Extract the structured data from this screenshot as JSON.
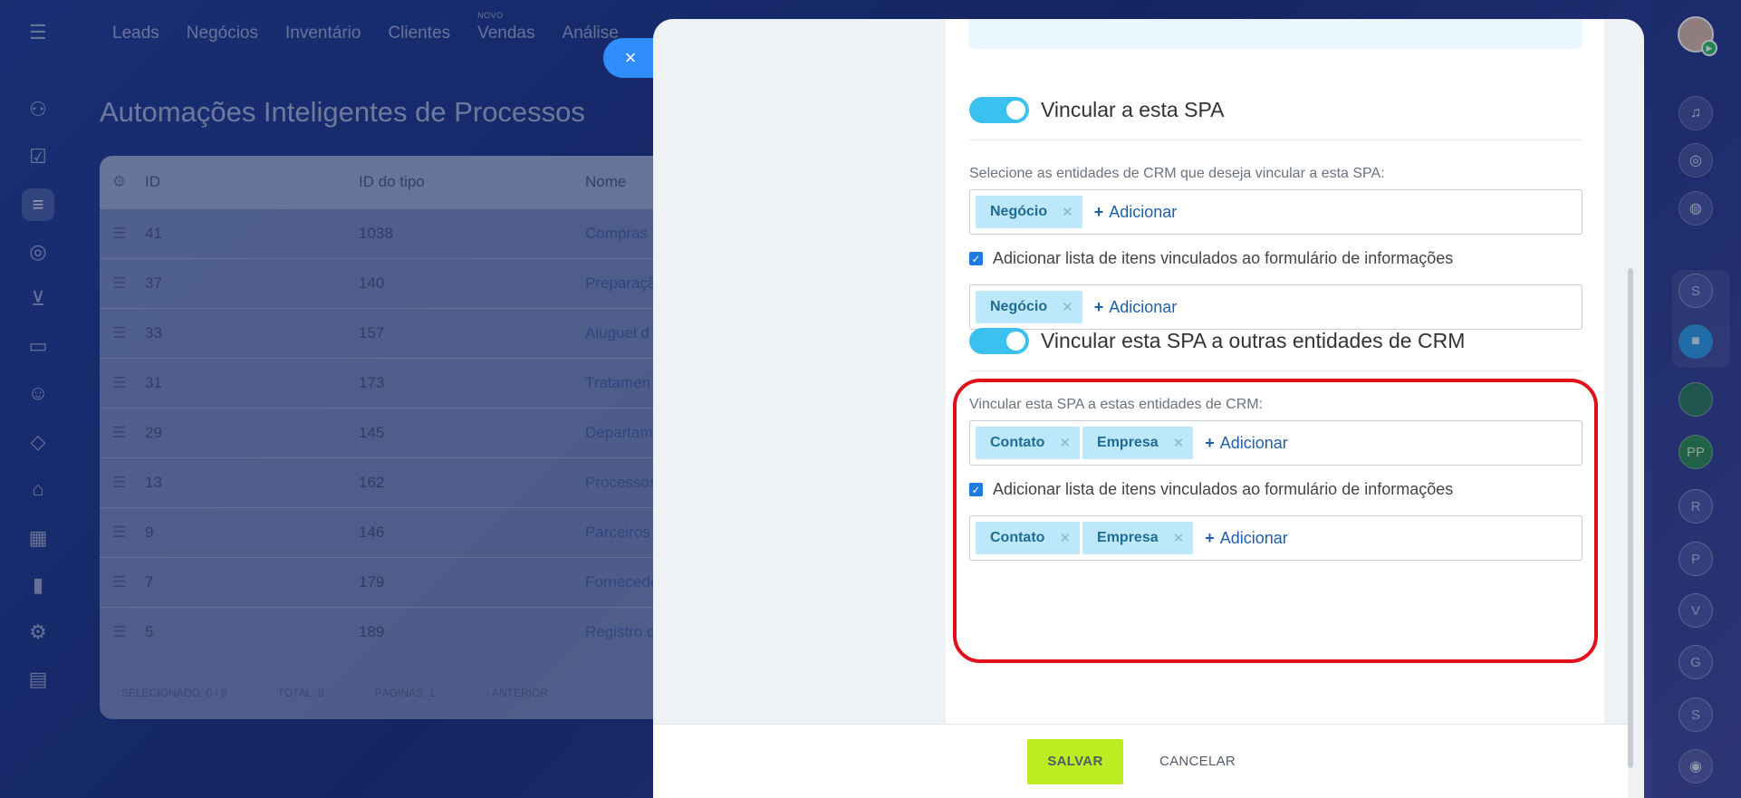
{
  "app": {
    "nav": [
      "Leads",
      "Negócios",
      "Inventário",
      "Clientes",
      "Vendas",
      "Análise"
    ],
    "nav_new_tag": "NOVO",
    "page_title": "Automações Inteligentes de Processos",
    "table": {
      "headers": [
        "ID",
        "ID do tipo",
        "Nome"
      ],
      "rows": [
        {
          "id": "41",
          "type": "1038",
          "name": "Compras"
        },
        {
          "id": "37",
          "type": "140",
          "name": "Preparaçã"
        },
        {
          "id": "33",
          "type": "157",
          "name": "Aluguel d"
        },
        {
          "id": "31",
          "type": "173",
          "name": "Tratamen"
        },
        {
          "id": "29",
          "type": "145",
          "name": "Departam"
        },
        {
          "id": "13",
          "type": "162",
          "name": "Processos"
        },
        {
          "id": "9",
          "type": "146",
          "name": "Parceiros"
        },
        {
          "id": "7",
          "type": "179",
          "name": "Fornecede"
        },
        {
          "id": "5",
          "type": "189",
          "name": "Registro d"
        }
      ],
      "footer": {
        "selected": "SELECIONADO: 0 / 9",
        "total": "TOTAL: 9",
        "pages": "PÁGINAS: 1",
        "prev": "‹ ANTERIOR"
      }
    },
    "right_rail_letters": [
      "S",
      "R",
      "P",
      "V",
      "G",
      "S"
    ],
    "right_rail_pp": "PP"
  },
  "slider": {
    "close_icon": "×",
    "section1": {
      "title": "Vincular a esta SPA",
      "label": "Selecione as entidades de CRM que deseja vincular a esta SPA:",
      "tags_top": [
        "Negócio"
      ],
      "add": "Adicionar",
      "checkbox_label": "Adicionar lista de itens vinculados ao formulário de informações",
      "tags_bottom": [
        "Negócio"
      ]
    },
    "section2": {
      "title": "Vincular esta SPA a outras entidades de CRM",
      "label": "Vincular esta SPA a estas entidades de CRM:",
      "tags_top": [
        "Contato",
        "Empresa"
      ],
      "add": "Adicionar",
      "checkbox_label": "Adicionar lista de itens vinculados ao formulário de informações",
      "tags_bottom": [
        "Contato",
        "Empresa"
      ]
    },
    "footer": {
      "save": "SALVAR",
      "cancel": "CANCELAR"
    },
    "colors": {
      "toggle_on": "#3bc1f0",
      "save": "#bbed21",
      "highlight": "#e0101c",
      "tag_bg": "#bde8fb"
    }
  }
}
